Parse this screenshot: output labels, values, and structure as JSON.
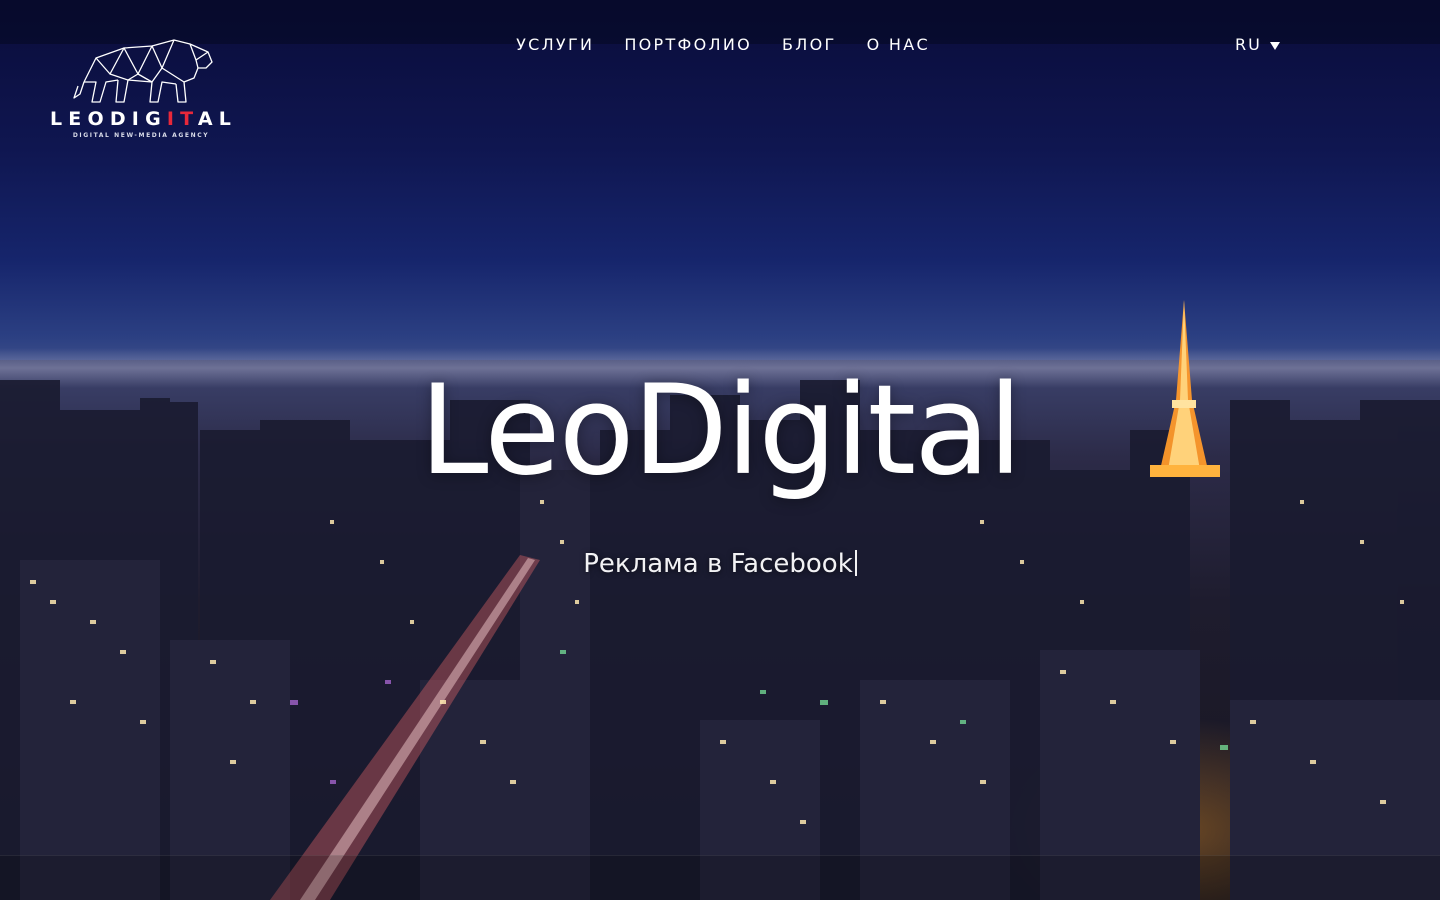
{
  "brand": {
    "logo_wordmark_pre": "LEODIG",
    "logo_wordmark_accent": "IT",
    "logo_wordmark_post": "AL",
    "logo_tagline": "DIGITAL NEW-MEDIA AGENCY",
    "accent_color": "#e8283a"
  },
  "nav": {
    "items": [
      {
        "label": "УСЛУГИ"
      },
      {
        "label": "ПОРТФОЛИО"
      },
      {
        "label": "БЛОГ"
      },
      {
        "label": "О НАС"
      }
    ]
  },
  "language": {
    "current": "RU",
    "icon": "chevron-down-icon"
  },
  "hero": {
    "title": "LeoDigital",
    "subtitle": "Реклама в Facebook"
  }
}
